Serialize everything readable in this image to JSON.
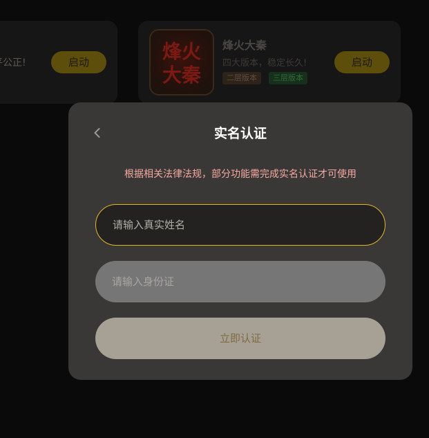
{
  "background_cards": [
    {
      "desc_fragment": "平公正!",
      "launch_label": "启动"
    },
    {
      "title": "烽火大秦",
      "subtitle": "四大版本，稳定长久!",
      "tags": [
        "二层版本",
        "三层版本"
      ],
      "launch_label": "启动",
      "thumbnail_text": "烽火大秦"
    }
  ],
  "modal": {
    "title": "实名认证",
    "notice": "根据相关法律法规，部分功能需完成实名认证才可使用",
    "name_placeholder": "请输入真实姓名",
    "id_placeholder": "请输入身份证",
    "submit_label": "立即认证",
    "back_icon": "chevron-left-icon"
  },
  "colors": {
    "accent_border": "#e5b82a",
    "notice_text": "#f6a9a0",
    "modal_bg": "#393837",
    "submit_bg": "#a7a095"
  }
}
